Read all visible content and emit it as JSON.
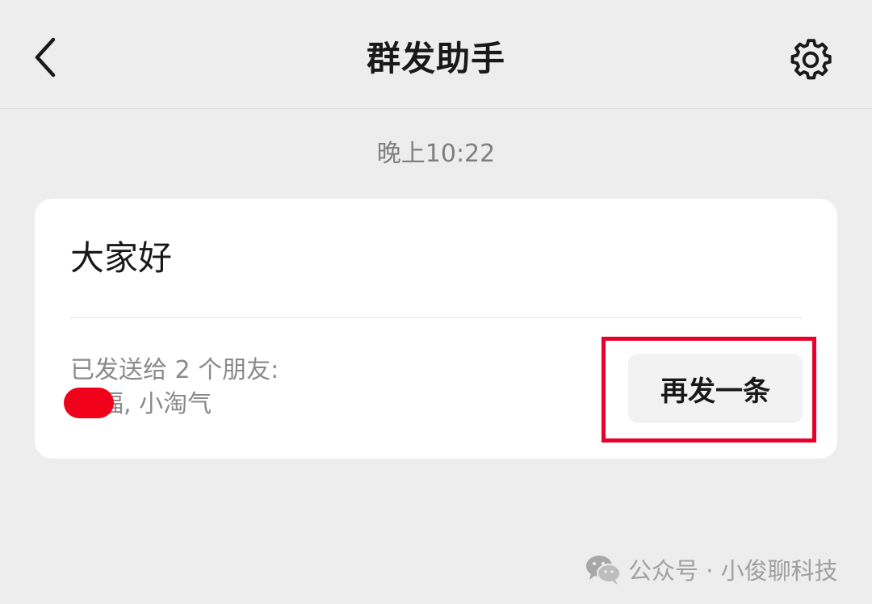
{
  "header": {
    "title": "群发助手",
    "back_icon": "chevron-left-icon",
    "settings_icon": "gear-icon"
  },
  "timestamp": "晚上10:22",
  "message_card": {
    "text": "大家好",
    "sent_summary": "已发送给 2 个朋友:",
    "recipients_visible": "福, 小淘气",
    "resend_label": "再发一条"
  },
  "watermark": {
    "text": "公众号 · 小俊聊科技",
    "icon": "wechat-icon"
  },
  "colors": {
    "background": "#ededed",
    "card": "#ffffff",
    "highlight": "#e8002a",
    "redaction": "#f0001b"
  }
}
